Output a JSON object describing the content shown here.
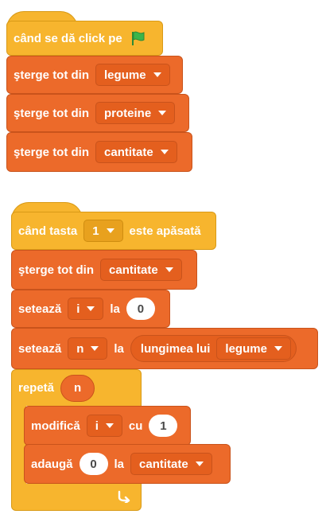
{
  "script1": {
    "hat": {
      "text": "când se dă click pe",
      "icon": "green-flag-icon"
    },
    "blocks": [
      {
        "text": "şterge tot din",
        "list": "legume"
      },
      {
        "text": "şterge tot din",
        "list": "proteine"
      },
      {
        "text": "şterge tot din",
        "list": "cantitate"
      }
    ]
  },
  "script2": {
    "hat": {
      "text_before": "când tasta",
      "key": "1",
      "text_after": "este apăsată"
    },
    "clear": {
      "text": "şterge tot din",
      "list": "cantitate"
    },
    "set_i": {
      "text": "setează",
      "var": "i",
      "mid": "la",
      "value": "0"
    },
    "set_n": {
      "text": "setează",
      "var": "n",
      "mid": "la",
      "reporter_text": "lungimea lui",
      "reporter_list": "legume"
    },
    "repeat": {
      "text": "repetă",
      "count": "n"
    },
    "change_i": {
      "text": "modifică",
      "var": "i",
      "mid": "cu",
      "value": "1"
    },
    "add": {
      "text": "adaugă",
      "value": "0",
      "mid": "la",
      "list": "cantitate"
    }
  },
  "colors": {
    "events": "#f7b52e",
    "data_list": "#ec6a2a",
    "control": "#f7b52e",
    "flag": "#3bb54a"
  }
}
